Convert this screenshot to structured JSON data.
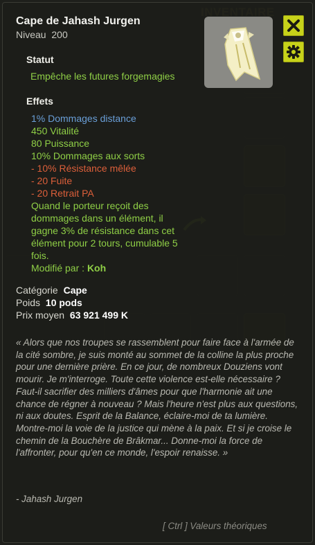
{
  "background": {
    "inventory_title": "INVENTAIRE"
  },
  "item": {
    "name": "Cape de Jahash Jurgen",
    "level_label": "Niveau",
    "level_value": "200",
    "image_icon": "cape-item-icon"
  },
  "buttons": {
    "close_icon": "close-icon",
    "settings_icon": "gear-icon"
  },
  "statut": {
    "title": "Statut",
    "text": "Empêche les futures forgemagies"
  },
  "effets": {
    "title": "Effets",
    "lines": [
      {
        "text": "1% Dommages distance",
        "color": "#6a9fd8"
      },
      {
        "text": "450 Vitalité",
        "color": "#8fcf46"
      },
      {
        "text": "80 Puissance",
        "color": "#8fcf46"
      },
      {
        "text": "10% Dommages aux sorts",
        "color": "#8fcf46"
      },
      {
        "text": "- 10% Résistance mêlée",
        "color": "#dc5f3a"
      },
      {
        "text": "- 20 Fuite",
        "color": "#dc5f3a"
      },
      {
        "text": "- 20 Retrait PA",
        "color": "#dc5f3a"
      }
    ],
    "special": "Quand le porteur reçoit des dommages dans un élément, il gagne 3% de résistance dans cet élément pour 2 tours, cumulable 5 fois.",
    "modified_label": "Modifié par :",
    "modified_by": "Koh"
  },
  "properties": {
    "category_label": "Catégorie",
    "category_value": "Cape",
    "weight_label": "Poids",
    "weight_value": "10 pods",
    "price_label": "Prix moyen",
    "price_value": "63 921 499 K"
  },
  "lore": {
    "quote": "« Alors que nos troupes se rassemblent pour faire face à l'armée de la cité sombre, je suis monté au sommet de la colline la plus proche pour une dernière prière. En ce jour, de nombreux Douziens vont mourir. Je m'interroge. Toute cette violence est-elle nécessaire ? Faut-il sacrifier des milliers d'âmes pour que l'harmonie ait une chance de régner à nouveau ? Mais l'heure n'est plus aux questions, ni aux doutes. Esprit de la Balance, éclaire-moi de ta lumière. Montre-moi la voie de la justice qui mène à la paix. Et si je croise le chemin de la Bouchère de Brâkmar... Donne-moi la force de l'affronter, pour qu'en ce monde, l'espoir renaisse. »",
    "author": "- Jahash Jurgen"
  },
  "footer": {
    "hint": "[ Ctrl ] Valeurs théoriques"
  },
  "colors": {
    "accent_yellow": "#c7d21a",
    "effect_green": "#8fcf46",
    "effect_blue": "#6a9fd8",
    "effect_red": "#dc5f3a"
  }
}
